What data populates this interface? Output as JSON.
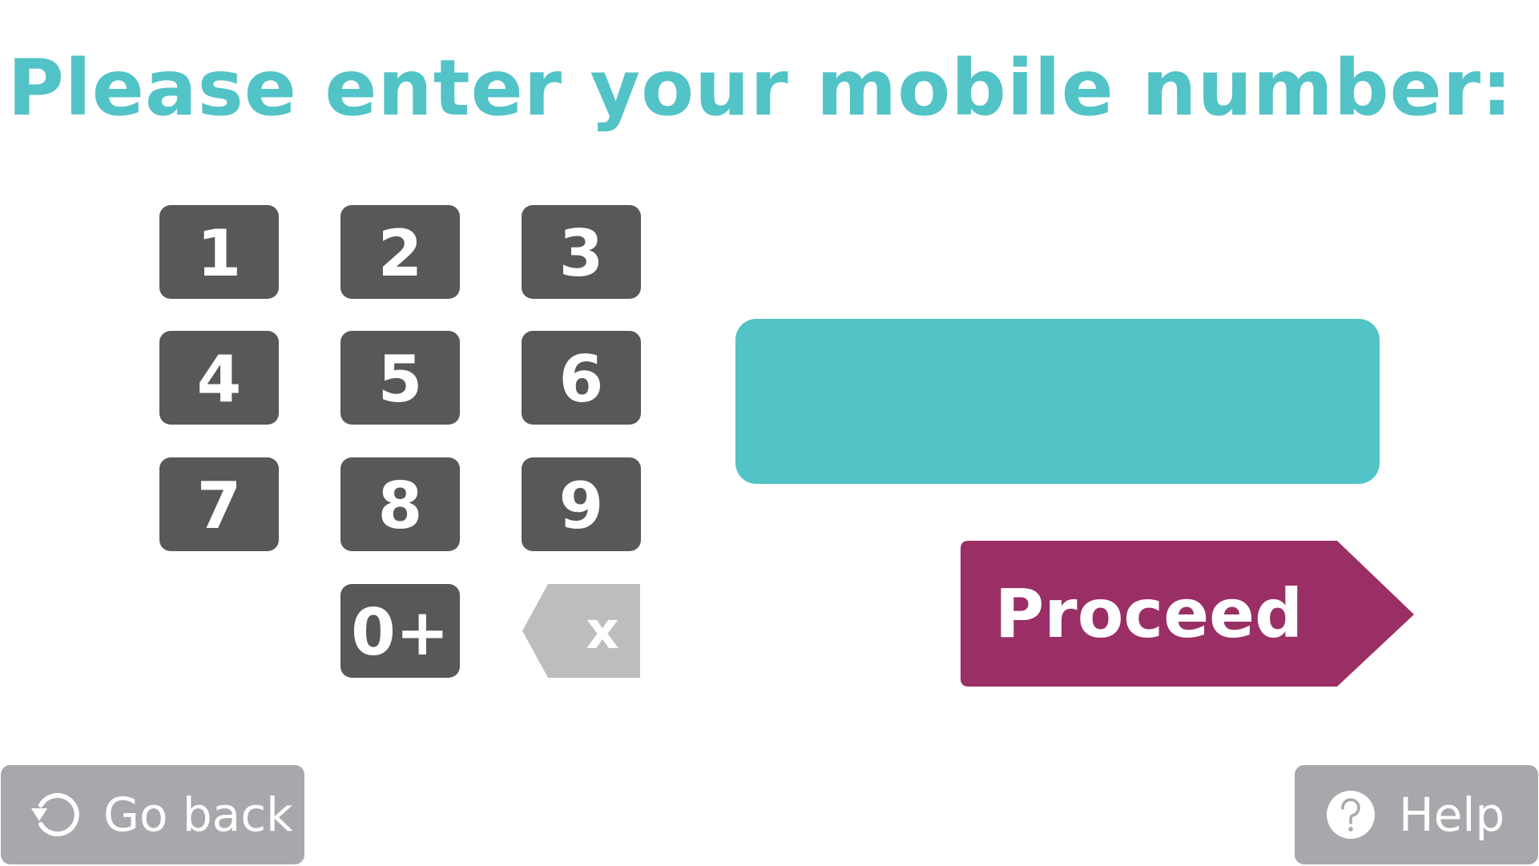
{
  "title": "Please enter your mobile number:",
  "keypad": {
    "keys": [
      "1",
      "2",
      "3",
      "4",
      "5",
      "6",
      "7",
      "8",
      "9",
      "0+"
    ],
    "delete_label": "x"
  },
  "phone_field": {
    "value": "",
    "placeholder": ""
  },
  "proceed_label": "Proceed",
  "footer": {
    "go_back_label": "Go back",
    "help_label": "Help"
  },
  "colors": {
    "accent": "#52c3c7",
    "key": "#58585a",
    "delete_key": "#bcbdbf",
    "proceed": "#9a2f65",
    "footer_button": "#a6a8ab"
  },
  "icons": {
    "delete": "backspace-icon",
    "go_back": "refresh-arrow-icon",
    "help": "question-circle-icon"
  }
}
